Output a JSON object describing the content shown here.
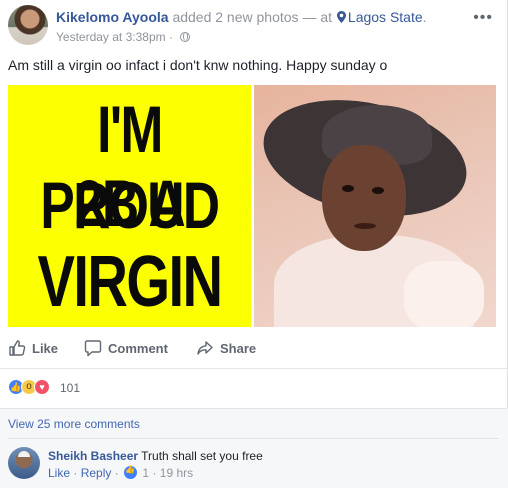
{
  "post": {
    "author": "Kikelomo Ayoola",
    "action_text": "added 2 new photos",
    "at_text": "— at",
    "location": "Lagos State",
    "location_suffix": ".",
    "timestamp": "Yesterday at 3:38pm",
    "separator": "·",
    "privacy_icon": "globe-icon",
    "menu_icon": "more-options-icon",
    "message": "Am still a virgin oo infact i don't knw nothing. Happy sunday o"
  },
  "photos": [
    {
      "kind": "text-graphic",
      "background": "#fcff00",
      "lines": [
        "I'M PROUD",
        "2B A",
        "VIRGIN"
      ]
    },
    {
      "kind": "portrait",
      "description_icon": "portrait-photo"
    }
  ],
  "actions": {
    "like_label": "Like",
    "comment_label": "Comment",
    "share_label": "Share"
  },
  "reactions": {
    "icons": [
      "like-reaction-icon",
      "wow-reaction-icon",
      "love-reaction-icon"
    ],
    "count": "101"
  },
  "comments": {
    "view_more": "View 25 more comments",
    "items": [
      {
        "author": "Sheikh Basheer",
        "text": "Truth shall set you free",
        "like_label": "Like",
        "dot": "·",
        "reply_label": "Reply",
        "dot2": "·",
        "likes": "1",
        "dot3": "·",
        "time": "19 hrs"
      }
    ]
  },
  "colors": {
    "link_blue": "#365899",
    "meta_gray": "#90949c",
    "yellow": "#fcff00",
    "like_blue": "#4080ff",
    "love_red": "#f25268",
    "wow_yellow": "#f7c94b"
  }
}
